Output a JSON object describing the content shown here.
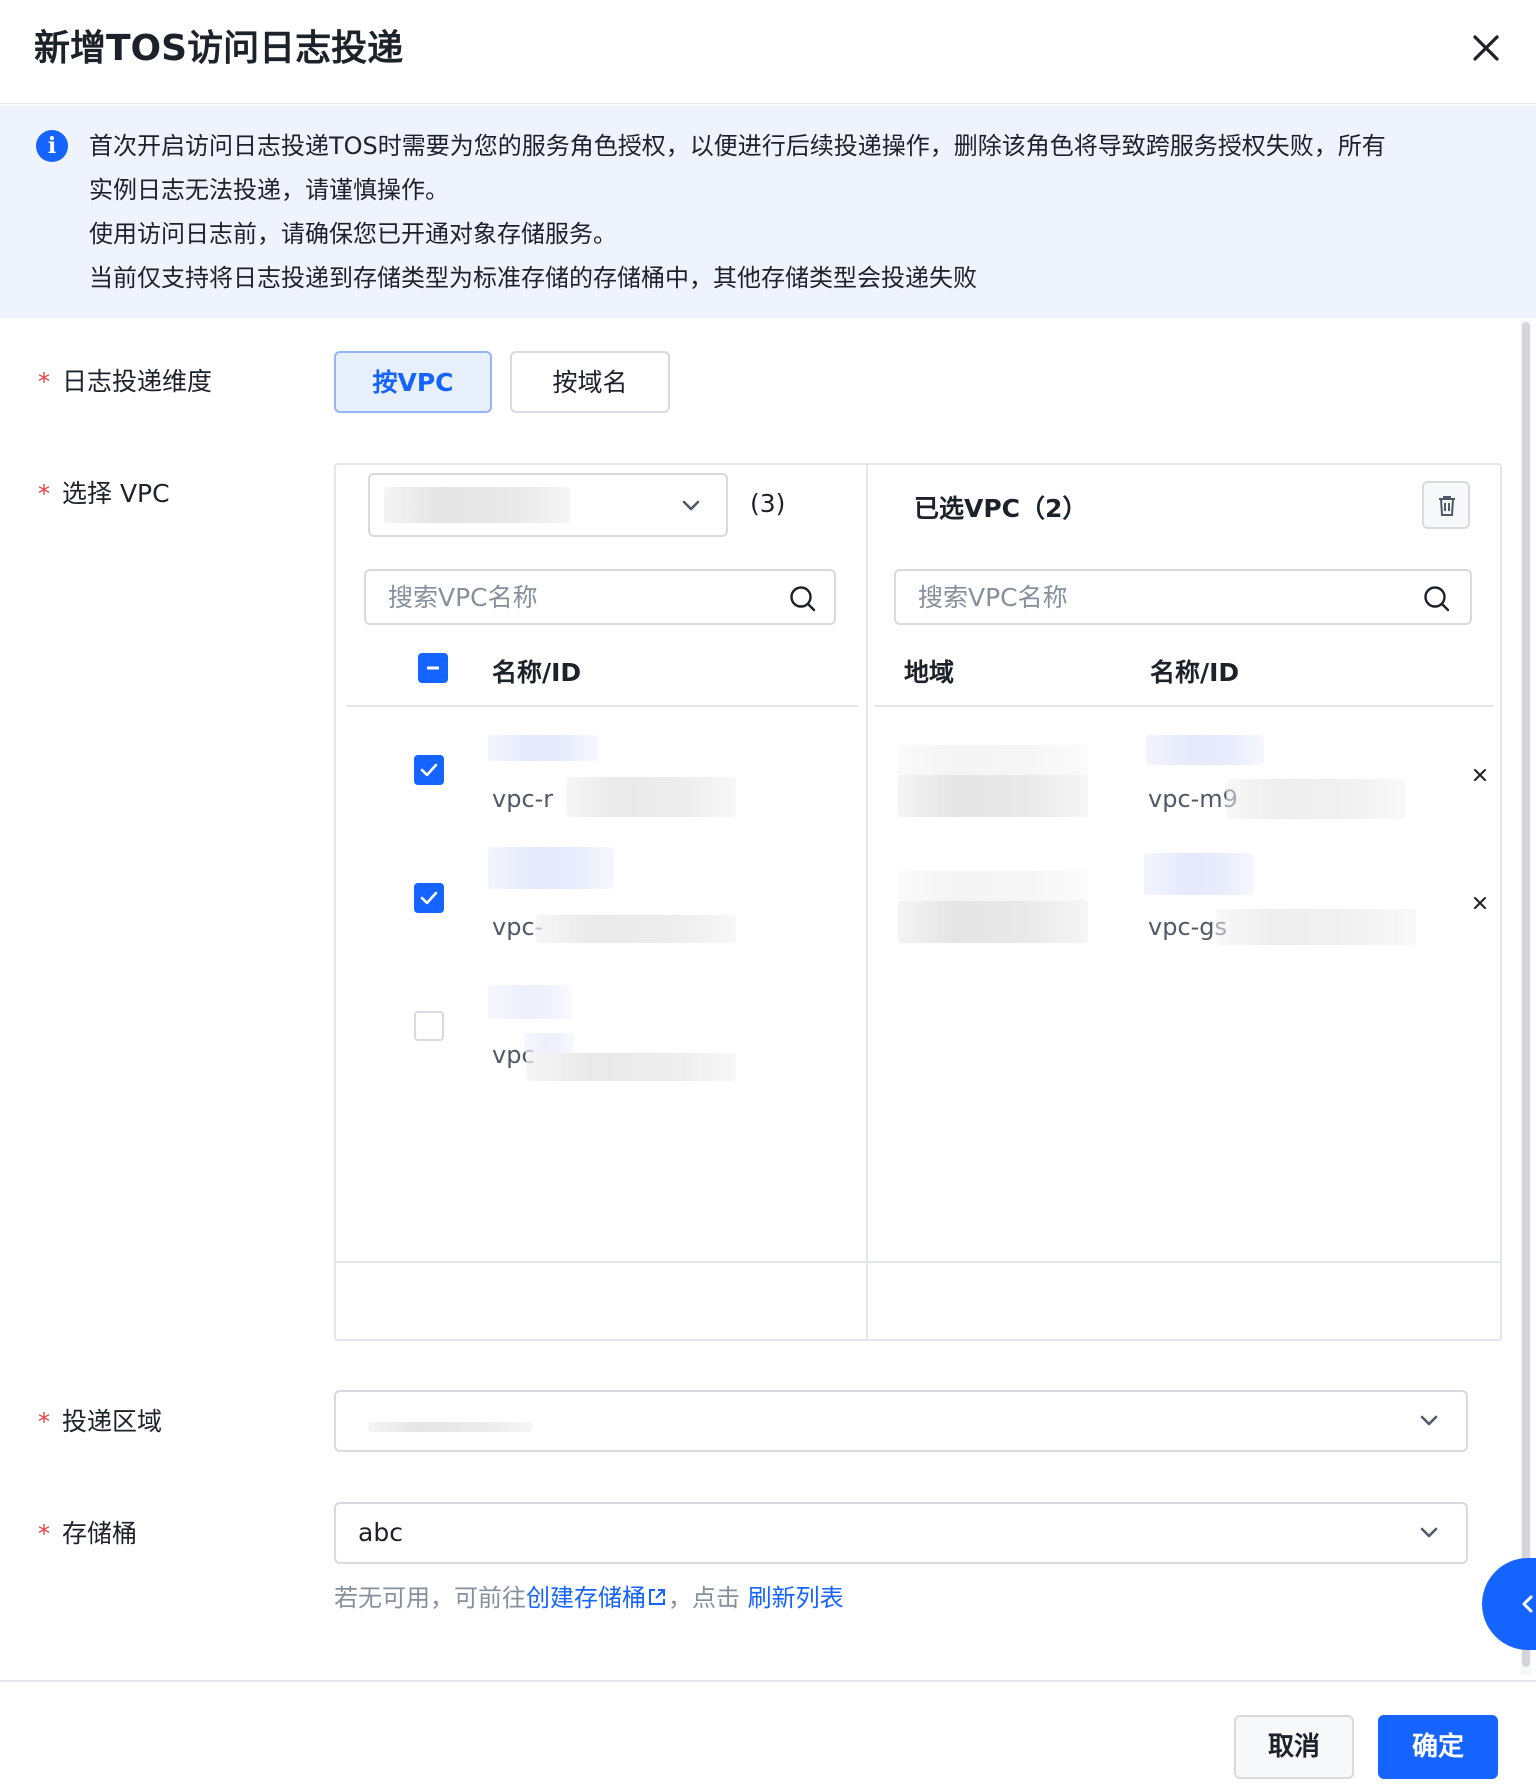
{
  "dialog": {
    "title": "新增TOS访问日志投递",
    "close_icon": "close-icon"
  },
  "alert": {
    "icon": "info-icon",
    "lines": [
      "首次开启访问日志投递TOS时需要为您的服务角色授权，以便进行后续投递操作，删除该角色将导致跨服务授权失败，所有",
      "实例日志无法投递，请谨慎操作。",
      "使用访问日志前，请确保您已开通对象存储服务。",
      "当前仅支持将日志投递到存储类型为标准存储的存储桶中，其他存储类型会投递失败"
    ]
  },
  "form": {
    "dimension": {
      "required_mark": "*",
      "label": "日志投递维度",
      "options": [
        "按VPC",
        "按域名"
      ],
      "selected": "按VPC"
    },
    "vpc": {
      "required_mark": "*",
      "label": "选择 VPC",
      "source": {
        "count": "(3)",
        "search_placeholder": "搜索VPC名称",
        "column_name": "名称/ID",
        "rows": [
          {
            "id_prefix": "vpc-r",
            "checked": true
          },
          {
            "id_prefix": "vpc-",
            "checked": true
          },
          {
            "id_prefix": "vpc",
            "checked": false
          }
        ]
      },
      "target": {
        "title": "已选VPC（2）",
        "search_placeholder": "搜索VPC名称",
        "column_region": "地域",
        "column_name": "名称/ID",
        "rows": [
          {
            "id_prefix": "vpc-m9"
          },
          {
            "id_prefix": "vpc-gs"
          }
        ]
      }
    },
    "region": {
      "required_mark": "*",
      "label": "投递区域"
    },
    "bucket": {
      "required_mark": "*",
      "label": "存储桶",
      "value": "abc",
      "help_prefix": "若无可用，可前往",
      "help_create_link": "创建存储桶",
      "help_middle": "，点击 ",
      "help_refresh_link": "刷新列表"
    }
  },
  "footer": {
    "cancel_label": "取消",
    "ok_label": "确定"
  },
  "colors": {
    "primary": "#1664ff",
    "required": "#f53f3f",
    "alert_bg": "#eef3fe"
  }
}
